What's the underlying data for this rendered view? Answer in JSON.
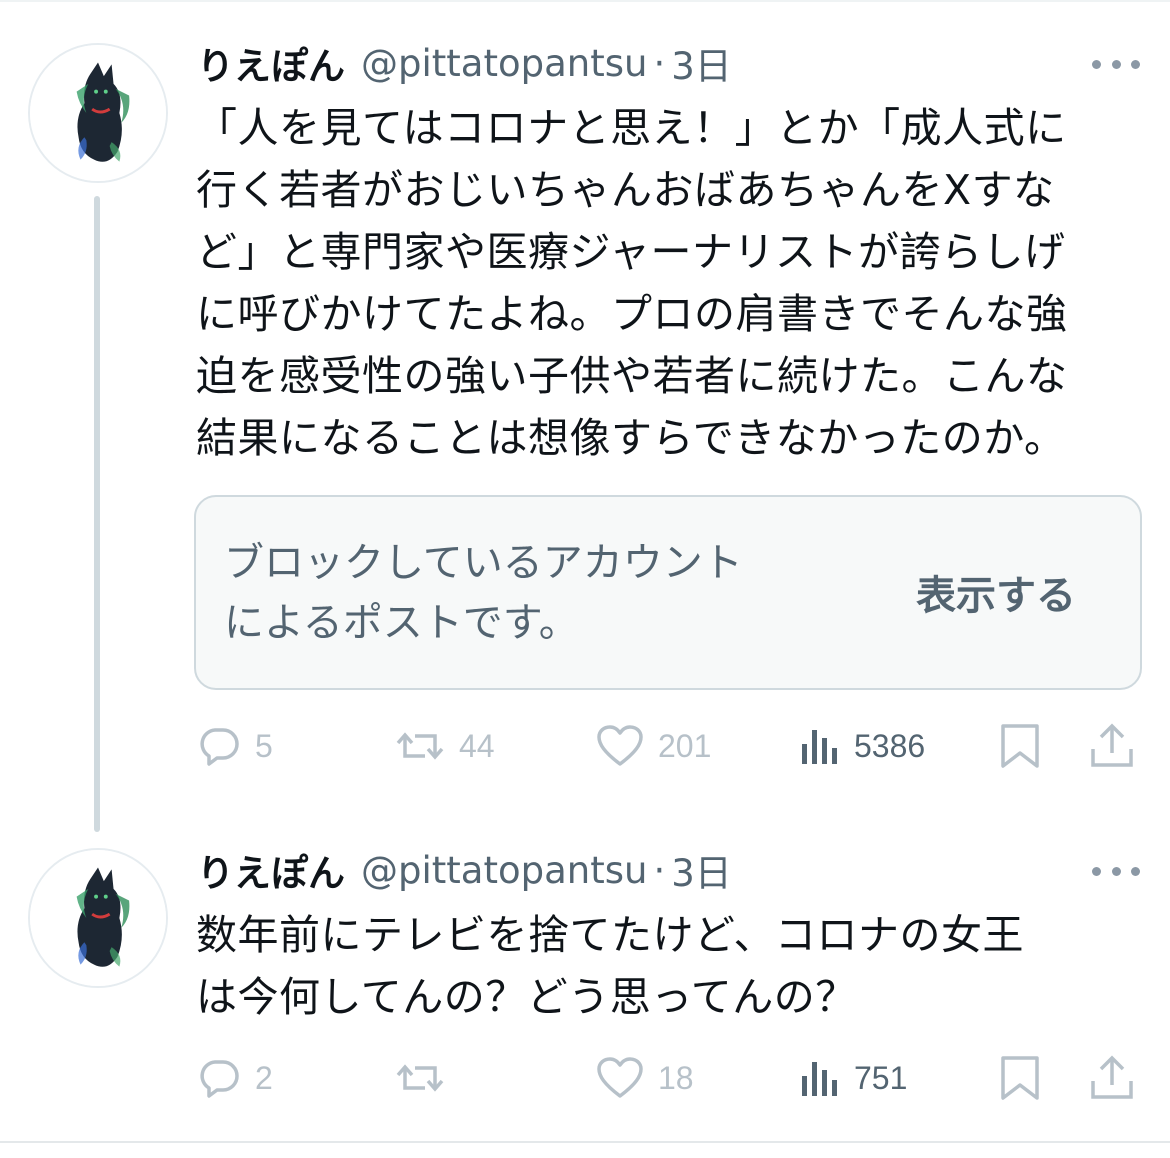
{
  "tweets": [
    {
      "display_name": "りえぽん",
      "handle": "@pittatopantsu",
      "separator": "·",
      "time": "3日",
      "text": "「人を見てはコロナと思え！」とか「成人式に\n行く若者がおじいちゃんおばあちゃんをXすな\nど」と専門家や医療ジャーナリストが誇らしげ\nに呼びかけてたよね。プロの肩書きでそんな強\n迫を感受性の強い子供や若者に続けた。こんな\n結果になることは想像すらできなかったのか。",
      "blocked": {
        "message": "ブロックしているアカウント\nによるポストです。",
        "button_label": "表示する"
      },
      "replies": "5",
      "reposts": "44",
      "likes": "201",
      "views": "5386"
    },
    {
      "display_name": "りえぽん",
      "handle": "@pittatopantsu",
      "separator": "·",
      "time": "3日",
      "text": "数年前にテレビを捨てたけど、コロナの女王\nは今何してんの？どう思ってんの？",
      "replies": "2",
      "reposts": "",
      "likes": "18",
      "views": "751"
    }
  ],
  "icons": {
    "reply": "reply-icon",
    "repost": "repost-icon",
    "like": "like-icon",
    "views": "views-icon",
    "bookmark": "bookmark-icon",
    "share": "share-icon",
    "more": "more-icon"
  },
  "colors": {
    "text": "#0f1419",
    "secondary": "#536471",
    "muted_action": "#b7c1c9",
    "thread_line": "#cfd9de",
    "card_background": "#f7f9f9"
  }
}
